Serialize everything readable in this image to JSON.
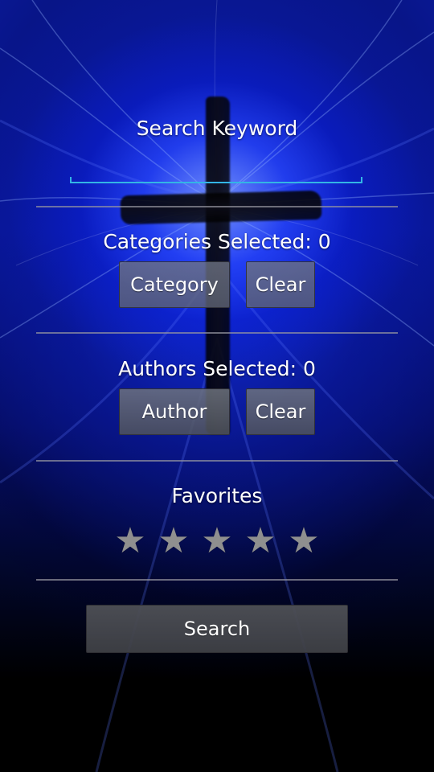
{
  "keyword": {
    "label": "Search Keyword",
    "value": "",
    "placeholder": ""
  },
  "categories": {
    "label": "Categories Selected: 0",
    "button_label": "Category",
    "clear_label": "Clear"
  },
  "authors": {
    "label": "Authors Selected: 0",
    "button_label": "Author",
    "clear_label": "Clear"
  },
  "favorites": {
    "label": "Favorites",
    "rating_selected": 0,
    "rating_max": 5,
    "stars": [
      "★",
      "★",
      "★",
      "★",
      "★"
    ]
  },
  "search": {
    "button_label": "Search"
  },
  "colors": {
    "input_underline": "#33b5e5",
    "star_inactive": "#8f8f8f",
    "background_accent": "#1a3cff"
  }
}
